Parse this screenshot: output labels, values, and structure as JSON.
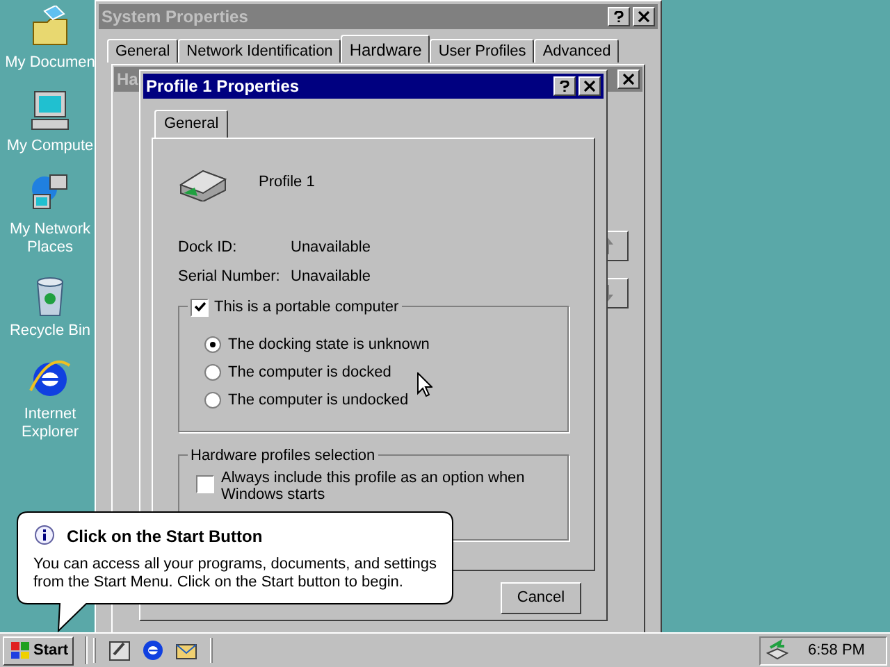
{
  "desktop_icons": [
    {
      "kind": "documents",
      "label": "My Documen"
    },
    {
      "kind": "computer",
      "label": "My Compute"
    },
    {
      "kind": "network",
      "label": "My Network Places"
    },
    {
      "kind": "recycle",
      "label": "Recycle Bin"
    },
    {
      "kind": "browser",
      "label": "Internet Explorer"
    }
  ],
  "system_window": {
    "title": "System Properties",
    "active": false,
    "tabs": [
      {
        "label": "General",
        "selected": false
      },
      {
        "label": "Network Identification",
        "selected": false
      },
      {
        "label": "Hardware",
        "selected": true
      },
      {
        "label": "User Profiles",
        "selected": false
      },
      {
        "label": "Advanced",
        "selected": false
      }
    ]
  },
  "profiles_window": {
    "title": "Ha",
    "active": false
  },
  "profile_window": {
    "title": "Profile 1 Properties",
    "active": true,
    "tabs": [
      {
        "label": "General",
        "selected": true
      }
    ],
    "profile_name": "Profile 1",
    "fields": [
      {
        "label": "Dock ID:",
        "value": "Unavailable"
      },
      {
        "label": "Serial Number:",
        "value": "Unavailable"
      }
    ],
    "portable": {
      "label": "This is a portable computer",
      "checked": true
    },
    "dock_options": [
      {
        "label": "The docking state is unknown",
        "selected": true
      },
      {
        "label": "The computer is docked",
        "selected": false
      },
      {
        "label": "The computer is undocked",
        "selected": false
      }
    ],
    "selection_group": {
      "title": "Hardware profiles selection",
      "option": {
        "label": "Always include this profile as an option when Windows starts",
        "checked": false
      }
    },
    "buttons": [
      "Cancel"
    ]
  },
  "balloon": {
    "title": "Click on the Start Button",
    "text": "You can access all your programs, documents, and settings from the Start Menu. Click on the Start button to begin."
  },
  "taskbar": {
    "start": "Start",
    "quick_launch": [
      {
        "kind": "desktop"
      },
      {
        "kind": "browser"
      },
      {
        "kind": "outlook"
      }
    ],
    "clock": "6:58 PM"
  }
}
